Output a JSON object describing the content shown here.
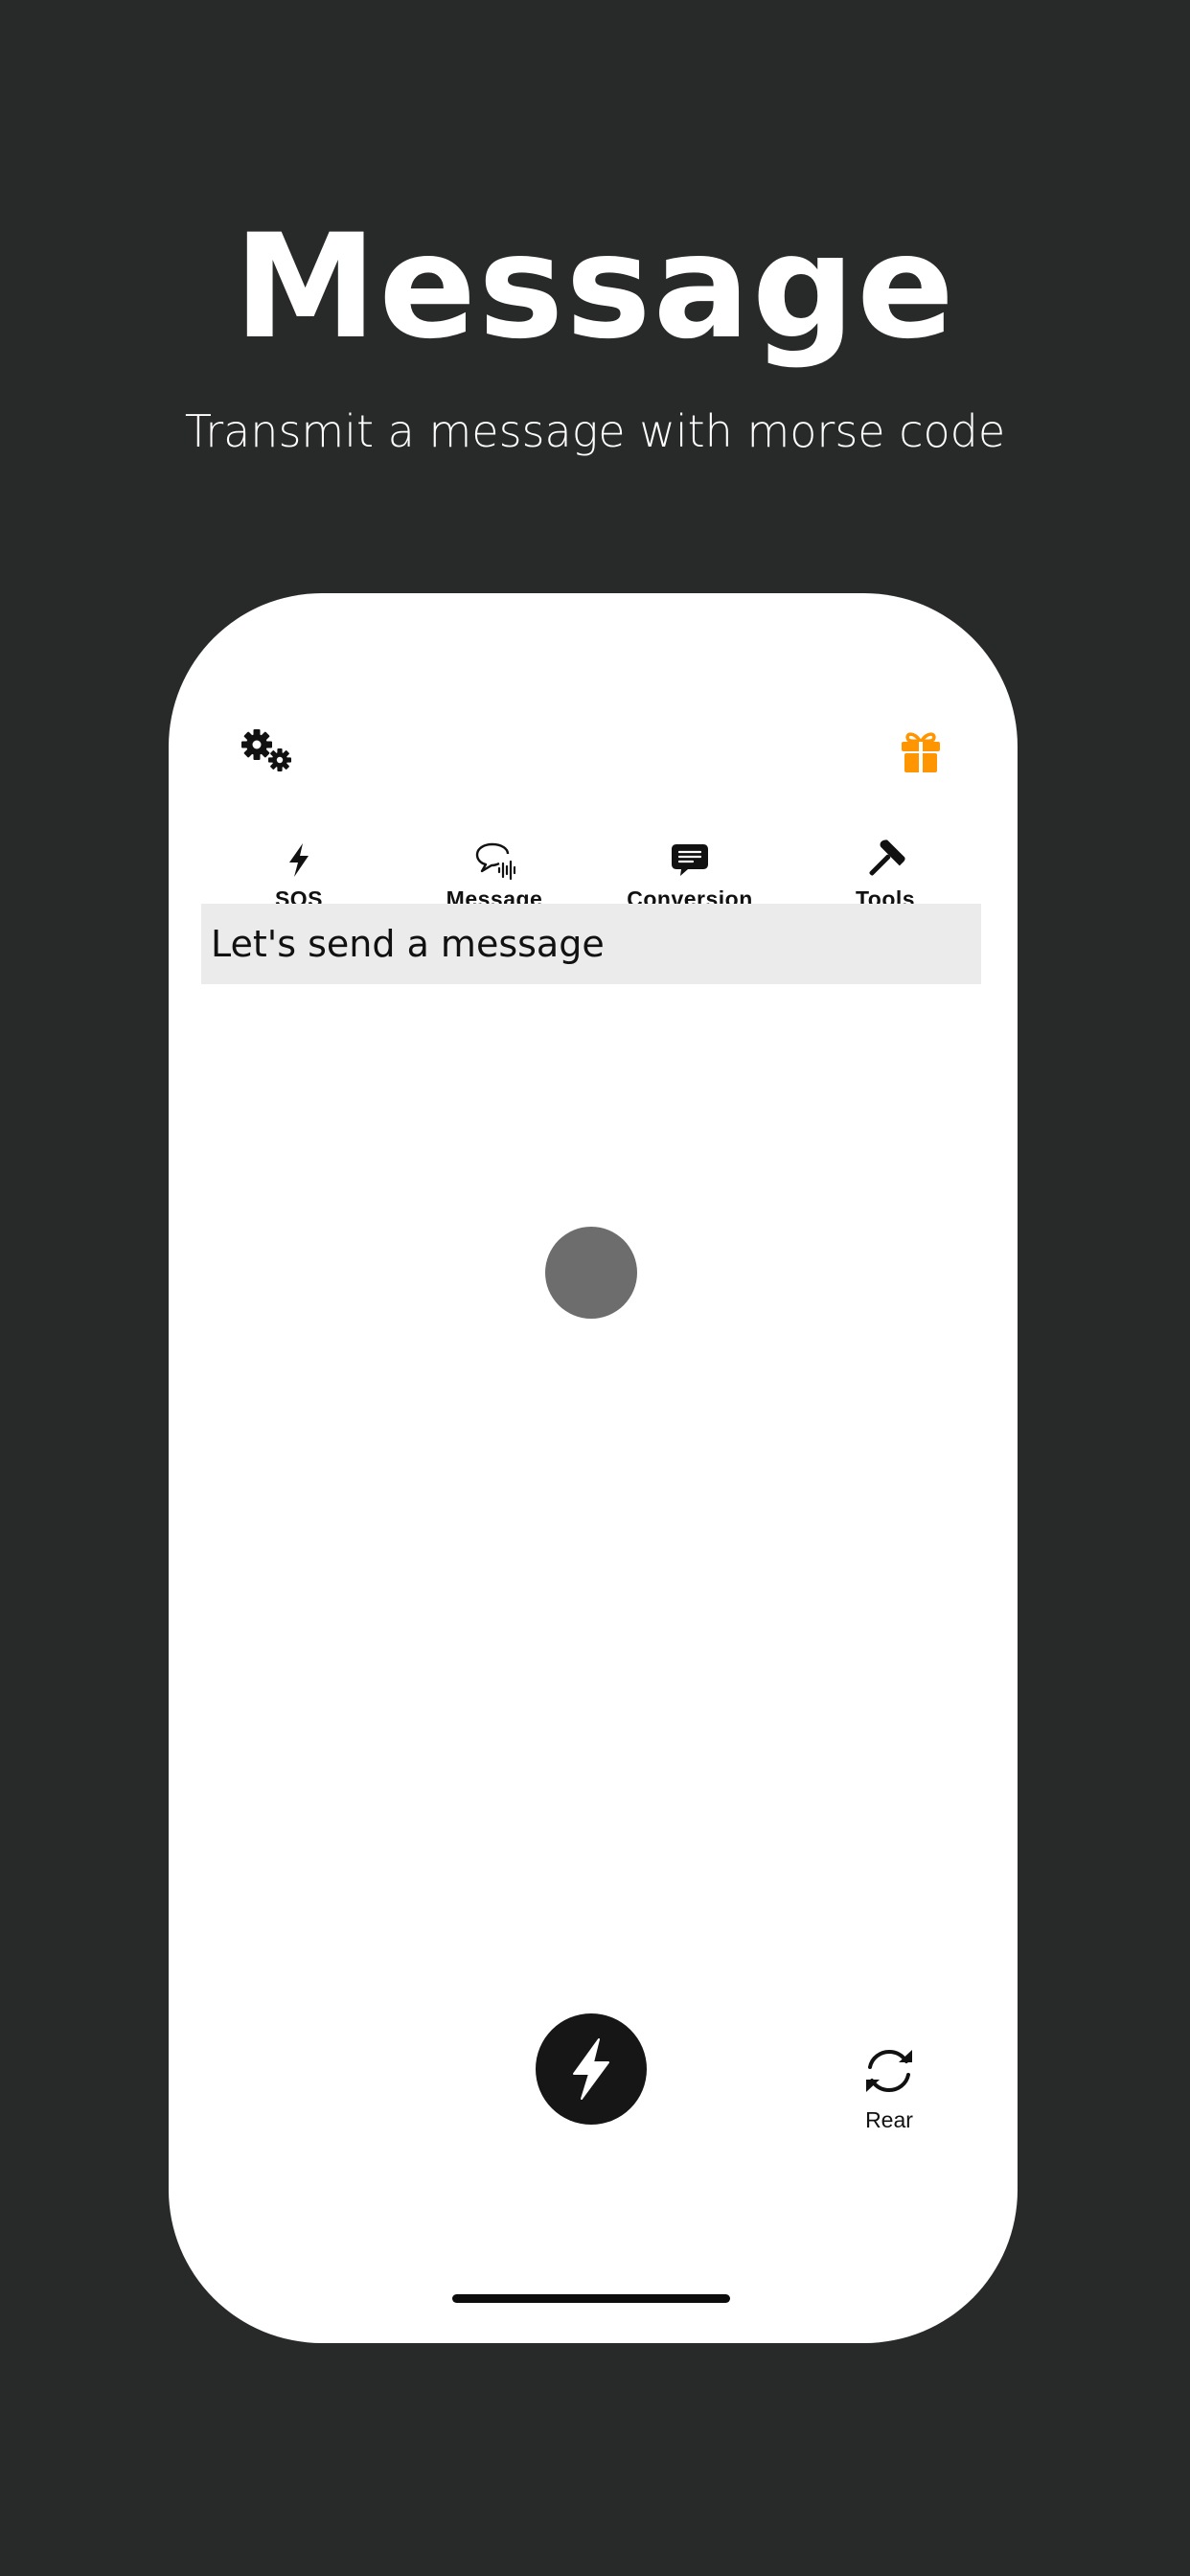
{
  "hero": {
    "title": "Message",
    "subtitle": "Transmit a message with morse code"
  },
  "app": {
    "top_bar": {
      "settings_icon": "gears-icon",
      "gift_icon": "gift-icon",
      "gift_color": "#FF9500"
    },
    "tabs": [
      {
        "label": "SOS",
        "icon": "bolt-icon",
        "active": false
      },
      {
        "label": "Message",
        "icon": "speech-bubble-waveform-icon",
        "active": true
      },
      {
        "label": "Conversion",
        "icon": "text-bubble-icon",
        "active": false
      },
      {
        "label": "Tools",
        "icon": "hammer-icon",
        "active": false
      }
    ],
    "message_field": {
      "placeholder": "Let's send a message"
    },
    "morse_light": {
      "color": "#6D6D6D"
    },
    "flash_button": {
      "icon": "bolt-icon"
    },
    "camera_toggle": {
      "label": "Rear",
      "icon": "rotate-arrows-icon"
    }
  },
  "colors": {
    "background": "#282929",
    "phone_screen": "#FFFFFF",
    "accent": "#FF9500",
    "field_background": "#EBEBEB"
  }
}
